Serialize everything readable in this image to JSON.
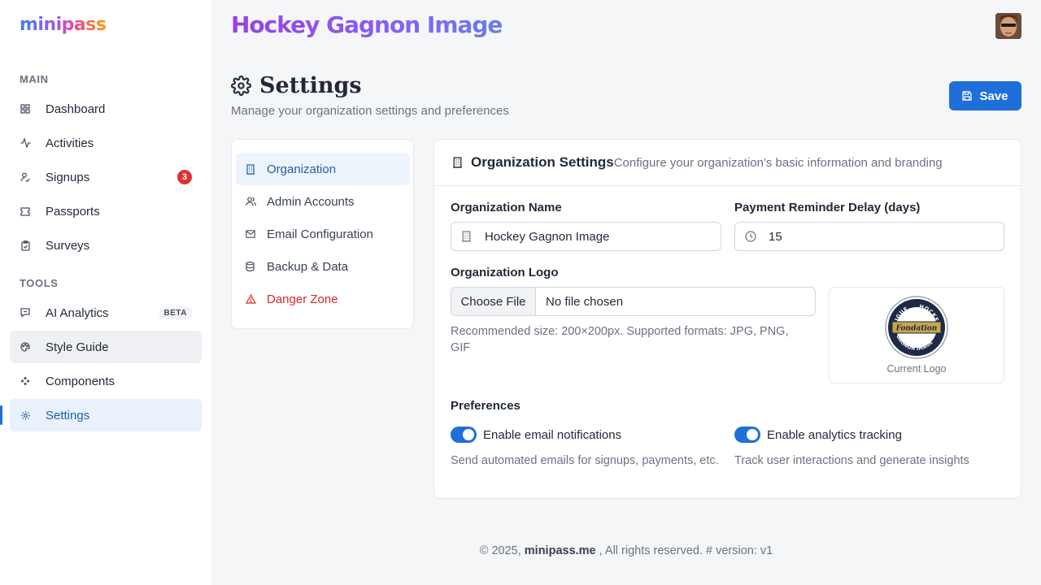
{
  "app": {
    "logo_text": "minipass"
  },
  "org": {
    "title": "Hockey Gagnon Image"
  },
  "sidebar": {
    "sections": [
      {
        "label": "MAIN"
      },
      {
        "label": "TOOLS"
      }
    ],
    "items": [
      {
        "label": "Dashboard",
        "icon": "grid-icon"
      },
      {
        "label": "Activities",
        "icon": "activity-icon"
      },
      {
        "label": "Signups",
        "icon": "signup-icon",
        "badge": "3"
      },
      {
        "label": "Passports",
        "icon": "ticket-icon"
      },
      {
        "label": "Surveys",
        "icon": "clipboard-icon"
      },
      {
        "label": "AI Analytics",
        "icon": "chat-icon",
        "badge": "BETA"
      },
      {
        "label": "Style Guide",
        "icon": "palette-icon"
      },
      {
        "label": "Components",
        "icon": "components-icon"
      },
      {
        "label": "Settings",
        "icon": "gear-icon"
      }
    ]
  },
  "page": {
    "title": "Settings",
    "subtitle": "Manage your organization settings and preferences",
    "save_label": "Save"
  },
  "settings_nav": [
    {
      "label": "Organization",
      "icon": "building-icon"
    },
    {
      "label": "Admin Accounts",
      "icon": "users-icon"
    },
    {
      "label": "Email Configuration",
      "icon": "mail-icon"
    },
    {
      "label": "Backup & Data",
      "icon": "database-icon"
    },
    {
      "label": "Danger Zone",
      "icon": "warning-icon"
    }
  ],
  "card": {
    "title": "Organization Settings",
    "description": "Configure your organization's basic information and branding",
    "org_name_label": "Organization Name",
    "org_name_value": "Hockey Gagnon Image",
    "reminder_label": "Payment Reminder Delay (days)",
    "reminder_value": "15",
    "logo_label": "Organization Logo",
    "file_button": "Choose File",
    "file_status": "No file chosen",
    "logo_help": "Recommended size: 200×200px. Supported formats: JPG, PNG, GIF",
    "logo_caption": "Current Logo",
    "logo_text": {
      "top": "LIGUE",
      "top2": "HOCKEY",
      "banner": "Fondation",
      "bottom": "GAGNON IMAGE"
    },
    "preferences_label": "Preferences",
    "pref_email_label": "Enable email notifications",
    "pref_email_desc": "Send automated emails for signups, payments, etc.",
    "pref_analytics_label": "Enable analytics tracking",
    "pref_analytics_desc": "Track user interactions and generate insights"
  },
  "footer": {
    "prefix": "© 2025,",
    "brand": "minipass.me",
    "suffix": ", All rights reserved. # version: v1"
  },
  "colors": {
    "accent": "#1e6fd9",
    "danger": "#dc2626",
    "badge": "#e03131"
  }
}
